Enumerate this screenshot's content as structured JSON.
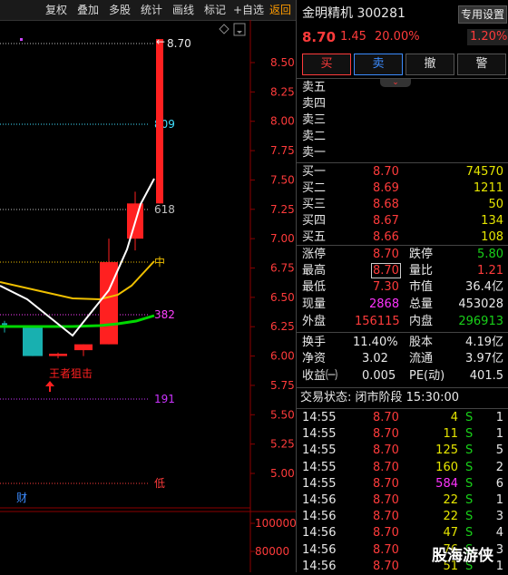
{
  "toolbar": {
    "items": [
      "复权",
      "叠加",
      "多股",
      "统计",
      "画线",
      "标记",
      "+自选",
      "返回"
    ]
  },
  "chart": {
    "price_labels": [
      "8.50",
      "8.25",
      "8.00",
      "7.75",
      "7.50",
      "7.25",
      "7.00",
      "6.75",
      "6.50",
      "6.25",
      "6.00",
      "5.75",
      "5.50",
      "5.25",
      "5.00"
    ],
    "volume_labels": [
      "100000",
      "80000"
    ],
    "level_labels": {
      "top": "8.70",
      "l809": "809",
      "l618": "618",
      "mid": "中",
      "l382": "382",
      "l191": "191",
      "low": "低"
    },
    "annotation": "王者狙击",
    "cai_label": "财",
    "watermark": "股海游侠"
  },
  "chart_data": {
    "type": "candlestick",
    "title": "",
    "ylim": [
      4.9,
      8.8
    ],
    "candles": [
      {
        "open": 6.27,
        "close": 6.28,
        "high": 6.3,
        "low": 6.2,
        "color": "cyan"
      },
      {
        "open": 6.0,
        "close": 6.25,
        "high": 6.26,
        "low": 6.0,
        "color": "cyan"
      },
      {
        "open": 6.02,
        "close": 6.0,
        "high": 6.03,
        "low": 5.98,
        "color": "red"
      },
      {
        "open": 6.05,
        "close": 6.1,
        "high": 6.1,
        "low": 6.0,
        "color": "red"
      },
      {
        "open": 6.1,
        "close": 6.8,
        "high": 7.0,
        "low": 6.1,
        "color": "red"
      },
      {
        "open": 7.3,
        "close": 7.0,
        "high": 7.4,
        "low": 6.9,
        "color": "red"
      },
      {
        "open": 7.3,
        "close": 8.7,
        "high": 8.7,
        "low": 7.3,
        "color": "red"
      }
    ]
  },
  "panel": {
    "stock_name": "金明精机 300281",
    "settings_btn": "专用设置",
    "price": "8.70",
    "change": "1.45",
    "change_pct": "20.00%",
    "side_pct": "1.20%",
    "buttons": [
      "买",
      "卖",
      "撤",
      "警"
    ],
    "sell_labels": [
      "卖五",
      "卖四",
      "卖三",
      "卖二",
      "卖一"
    ],
    "buy_rows": [
      {
        "label": "买一",
        "price": "8.70",
        "vol": "74570"
      },
      {
        "label": "买二",
        "price": "8.69",
        "vol": "1211"
      },
      {
        "label": "买三",
        "price": "8.68",
        "vol": "50"
      },
      {
        "label": "买四",
        "price": "8.67",
        "vol": "134"
      },
      {
        "label": "买五",
        "price": "8.66",
        "vol": "108"
      }
    ],
    "stats": {
      "zhangting_l": "涨停",
      "zhangting_v": "8.70",
      "dieting_l": "跌停",
      "dieting_v": "5.80",
      "zuigao_l": "最高",
      "zuigao_v": "8.70",
      "liangbi_l": "量比",
      "liangbi_v": "1.21",
      "zuidi_l": "最低",
      "zuidi_v": "7.30",
      "shizhi_l": "市值",
      "shizhi_v": "36.4亿",
      "xianliang_l": "现量",
      "xianliang_v": "2868",
      "zongliang_l": "总量",
      "zongliang_v": "453028",
      "waipan_l": "外盘",
      "waipan_v": "156115",
      "neipan_l": "内盘",
      "neipan_v": "296913",
      "huanshou_l": "换手",
      "huanshou_v": "11.40%",
      "guben_l": "股本",
      "guben_v": "4.19亿",
      "jingzi_l": "净资",
      "jingzi_v": "3.02",
      "liutong_l": "流通",
      "liutong_v": "3.97亿",
      "shouyi_l": "收益㈠",
      "shouyi_v": "0.005",
      "pe_l": "PE(动)",
      "pe_v": "401.5"
    },
    "trade_status": "交易状态: 闭市阶段 15:30:00",
    "trades": [
      {
        "time": "14:55",
        "price": "8.70",
        "vol": "4",
        "vc": "yellow",
        "side": "S",
        "n": "1"
      },
      {
        "time": "14:55",
        "price": "8.70",
        "vol": "11",
        "vc": "yellow",
        "side": "S",
        "n": "1"
      },
      {
        "time": "14:55",
        "price": "8.70",
        "vol": "125",
        "vc": "yellow",
        "side": "S",
        "n": "5"
      },
      {
        "time": "14:55",
        "price": "8.70",
        "vol": "160",
        "vc": "yellow",
        "side": "S",
        "n": "2"
      },
      {
        "time": "14:55",
        "price": "8.70",
        "vol": "584",
        "vc": "magenta",
        "side": "S",
        "n": "6"
      },
      {
        "time": "14:56",
        "price": "8.70",
        "vol": "22",
        "vc": "yellow",
        "side": "S",
        "n": "1"
      },
      {
        "time": "14:56",
        "price": "8.70",
        "vol": "22",
        "vc": "yellow",
        "side": "S",
        "n": "3"
      },
      {
        "time": "14:56",
        "price": "8.70",
        "vol": "47",
        "vc": "yellow",
        "side": "S",
        "n": "4"
      },
      {
        "time": "14:56",
        "price": "8.70",
        "vol": "76",
        "vc": "yellow",
        "side": "S",
        "n": "3"
      },
      {
        "time": "14:56",
        "price": "8.70",
        "vol": "51",
        "vc": "yellow",
        "side": "S",
        "n": "1"
      }
    ]
  }
}
